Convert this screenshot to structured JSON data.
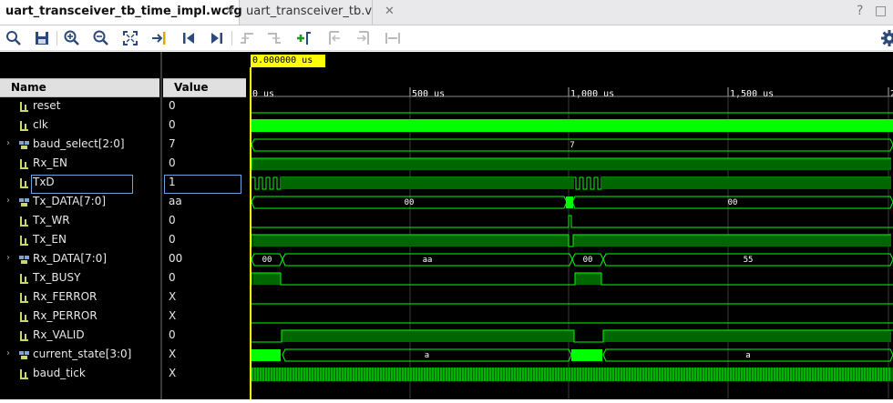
{
  "tabs": [
    {
      "label": "uart_transceiver_tb_time_impl.wcfg",
      "active": true
    },
    {
      "label": "uart_transceiver_tb.v",
      "active": false
    }
  ],
  "window_controls": {
    "help": "?",
    "restore": "□"
  },
  "toolbar_icons": [
    "search-icon",
    "save-icon",
    "zoom-in-icon",
    "zoom-out-icon",
    "zoom-fit-icon",
    "goto-cursor-icon",
    "goto-start-icon",
    "goto-end-icon",
    "prev-transition-icon",
    "next-transition-icon",
    "add-marker-icon",
    "prev-marker-icon",
    "next-marker-icon",
    "swap-cursors-icon",
    "settings-icon"
  ],
  "columns": {
    "name": "Name",
    "value": "Value"
  },
  "cursor": {
    "time": "0.000000 us"
  },
  "time_axis": {
    "ticks": [
      "0 us",
      "500 us",
      "1,000 us",
      "1,500 us",
      "2"
    ]
  },
  "signals": [
    {
      "name": "reset",
      "value": "0",
      "bus": false
    },
    {
      "name": "clk",
      "value": "0",
      "bus": false
    },
    {
      "name": "baud_select[2:0]",
      "value": "7",
      "bus": true
    },
    {
      "name": "Rx_EN",
      "value": "0",
      "bus": false
    },
    {
      "name": "TxD",
      "value": "1",
      "bus": false,
      "selected": true
    },
    {
      "name": "Tx_DATA[7:0]",
      "value": "aa",
      "bus": true
    },
    {
      "name": "Tx_WR",
      "value": "0",
      "bus": false
    },
    {
      "name": "Tx_EN",
      "value": "0",
      "bus": false
    },
    {
      "name": "Rx_DATA[7:0]",
      "value": "00",
      "bus": true
    },
    {
      "name": "Tx_BUSY",
      "value": "0",
      "bus": false
    },
    {
      "name": "Rx_FERROR",
      "value": "X",
      "bus": false
    },
    {
      "name": "Rx_PERROR",
      "value": "X",
      "bus": false
    },
    {
      "name": "Rx_VALID",
      "value": "0",
      "bus": false
    },
    {
      "name": "current_state[3:0]",
      "value": "X",
      "bus": true
    },
    {
      "name": "baud_tick",
      "value": "X",
      "bus": false
    }
  ],
  "bus_labels": {
    "baud_select": [
      "7"
    ],
    "tx_data": [
      "00",
      "00"
    ],
    "rx_data": [
      "00",
      "aa",
      "00",
      "55"
    ],
    "current_state": [
      "a",
      "a"
    ]
  },
  "colors": {
    "wave": "#00ff00",
    "wave_dim": "#006600",
    "background": "#000000",
    "cursor": "#ffff00",
    "selection": "#6fa0e0"
  }
}
